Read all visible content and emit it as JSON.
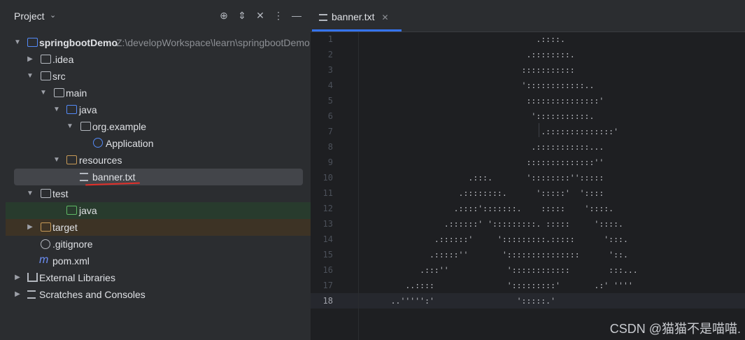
{
  "project_panel": {
    "title": "Project",
    "tree": [
      {
        "label": "springbootDemo",
        "path": "Z:\\developWorkspace\\learn\\springbootDemo",
        "icon": "module-folder-icon"
      },
      {
        "label": ".idea",
        "icon": "folder-icon"
      },
      {
        "label": "src",
        "icon": "folder-icon"
      },
      {
        "label": "main",
        "icon": "folder-icon"
      },
      {
        "label": "java",
        "icon": "source-folder-icon"
      },
      {
        "label": "org.example",
        "icon": "package-icon"
      },
      {
        "label": "Application",
        "icon": "spring-class-icon"
      },
      {
        "label": "resources",
        "icon": "resources-folder-icon"
      },
      {
        "label": "banner.txt",
        "icon": "text-file-icon"
      },
      {
        "label": "test",
        "icon": "folder-icon"
      },
      {
        "label": "java",
        "icon": "test-folder-icon"
      },
      {
        "label": "target",
        "icon": "excluded-folder-icon"
      },
      {
        "label": ".gitignore",
        "icon": "ignore-file-icon"
      },
      {
        "label": "pom.xml",
        "icon": "maven-icon"
      },
      {
        "label": "External Libraries",
        "icon": "library-icon"
      },
      {
        "label": "Scratches and Consoles",
        "icon": "scratches-icon"
      }
    ]
  },
  "editor": {
    "tab_label": "banner.txt",
    "line_numbers": [
      "1",
      "2",
      "3",
      "4",
      "5",
      "6",
      "7",
      "8",
      "9",
      "10",
      "11",
      "12",
      "13",
      "14",
      "15",
      "16",
      "17",
      "18"
    ],
    "lines": [
      "                                   .::::.",
      "                                 .::::::::.",
      "                                :::::::::::",
      "                                '::::::::::::..",
      "                                 :::::::::::::::'",
      "                                  ':::::::::::.",
      "                                    .::::::::::::::'",
      "                                  .:::::::::::...",
      "                                 ::::::::::::::''",
      "                     .:::.       '::::::::'':::::",
      "                   .::::::::.      ':::::'  '::::",
      "                  .::::':::::::.    :::::    '::::.",
      "                .::::::' ':::::::::. :::::     '::::.",
      "              .::::::'     ':::::::::.:::::      ':::.",
      "             .:::::''       ':::::::::::::::      '::.",
      "           .:::''            '::::::::::::        :::...",
      "        ..::::               ':::::::::'       .:' ''''",
      "     ..''''':'                 ':::::.'"
    ]
  },
  "watermark": "CSDN @猫猫不是喵喵."
}
